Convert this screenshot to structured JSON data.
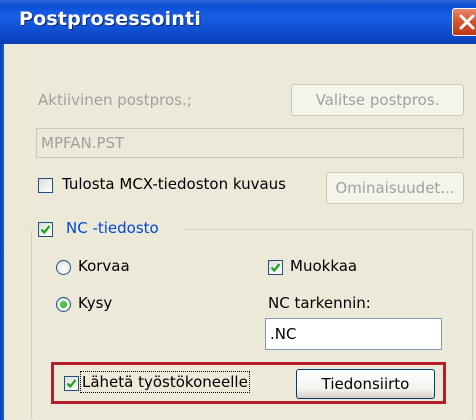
{
  "window": {
    "title": "Postprosessointi",
    "close_icon": "close-icon"
  },
  "postprocessor": {
    "active_label": "Aktiivinen postpros.;",
    "select_button": "Valitse postpros.",
    "current_value": "MPFAN.PST"
  },
  "print_description": {
    "label": "Tulosta MCX-tiedoston kuvaus",
    "checked": false,
    "properties_button": "Ominaisuudet..."
  },
  "nc_file": {
    "label": "NC -tiedosto",
    "checked": true,
    "overwrite_label": "Korvaa",
    "ask_label": "Kysy",
    "selected_option": "Kysy",
    "edit_label": "Muokkaa",
    "edit_checked": true,
    "extension_label": "NC tarkennin:",
    "extension_value": ".NC"
  },
  "send": {
    "label": "Lähetä työstökoneelle",
    "checked": true,
    "transfer_button": "Tiedonsiirto"
  },
  "colors": {
    "title_bar": "#0a4fd4",
    "highlight_border": "#b71c2c",
    "checkmark": "#21a121",
    "dialog_bg": "#ece9d8"
  }
}
